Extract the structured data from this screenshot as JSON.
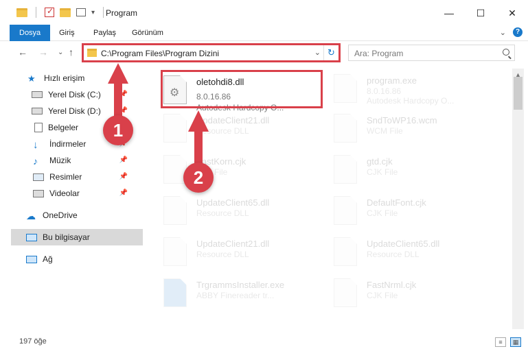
{
  "window": {
    "title": "Program",
    "minimize": "—",
    "maximize": "☐",
    "close": "✕"
  },
  "ribbon": {
    "tabs": [
      {
        "label": "Dosya"
      },
      {
        "label": "Giriş"
      },
      {
        "label": "Paylaş"
      },
      {
        "label": "Görünüm"
      }
    ],
    "help": "?",
    "collapse": "⌄"
  },
  "nav": {
    "back": "←",
    "forward": "→",
    "recent": "⌄",
    "up": "↑"
  },
  "address": {
    "path": "C:\\Program Files\\Program Dizini",
    "dropdown": "⌄",
    "refresh": "↻"
  },
  "search": {
    "placeholder": "Ara: Program"
  },
  "sidebar": {
    "items": [
      {
        "label": "Hızlı erişim"
      },
      {
        "label": "Yerel Disk (C:)"
      },
      {
        "label": "Yerel Disk (D:)"
      },
      {
        "label": "Belgeler"
      },
      {
        "label": "İndirmeler"
      },
      {
        "label": "Müzik"
      },
      {
        "label": "Resimler"
      },
      {
        "label": "Videolar"
      },
      {
        "label": "OneDrive"
      },
      {
        "label": "Bu bilgisayar"
      },
      {
        "label": "Ağ"
      }
    ],
    "pin": "📌"
  },
  "files": {
    "focused": {
      "name": "oletohdi8.dll",
      "version": "8.0.16.86",
      "description": "Autodesk Hardcopy O..."
    },
    "others": [
      {
        "name": "program.exe",
        "line1": "8.0.16.86",
        "line2": "Autodesk Hardcopy O..."
      },
      {
        "name": "UpdateClient21.dll",
        "line1": "Resource DLL"
      },
      {
        "name": "SndToWP16.wcm",
        "line1": "WCM File"
      },
      {
        "name": "FastKorn.cjk",
        "line1": "CJK File"
      },
      {
        "name": "gtd.cjk",
        "line1": "CJK File"
      },
      {
        "name": "UpdateClient65.dll",
        "line1": "Resource DLL"
      },
      {
        "name": "DefaultFont.cjk",
        "line1": "CJK File"
      },
      {
        "name": "UpdateClient21.dll",
        "line1": "Resource DLL"
      },
      {
        "name": "UpdateClient65.dll",
        "line1": "Resource DLL"
      },
      {
        "name": "TrgrammsInstaller.exe",
        "line1": "ABBY Finereader tr..."
      },
      {
        "name": "FastNrml.cjk",
        "line1": "CJK File"
      }
    ]
  },
  "status": {
    "count": "197 öğe"
  },
  "callouts": {
    "one": "1",
    "two": "2"
  },
  "colors": {
    "accent": "#1979ca",
    "highlight": "#d9404a"
  }
}
